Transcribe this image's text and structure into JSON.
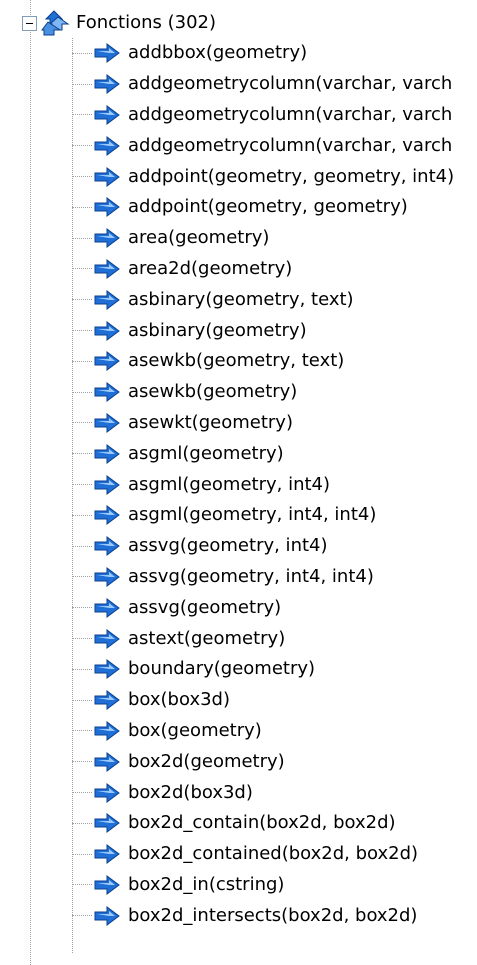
{
  "tree": {
    "root": {
      "label": "Fonctions (302)",
      "icon": "functions-folder-icon",
      "expanded": true
    },
    "items": [
      {
        "label": "addbbox(geometry)"
      },
      {
        "label": "addgeometrycolumn(varchar, varch"
      },
      {
        "label": "addgeometrycolumn(varchar, varch"
      },
      {
        "label": "addgeometrycolumn(varchar, varch"
      },
      {
        "label": "addpoint(geometry, geometry, int4)"
      },
      {
        "label": "addpoint(geometry, geometry)"
      },
      {
        "label": "area(geometry)"
      },
      {
        "label": "area2d(geometry)"
      },
      {
        "label": "asbinary(geometry, text)"
      },
      {
        "label": "asbinary(geometry)"
      },
      {
        "label": "asewkb(geometry, text)"
      },
      {
        "label": "asewkb(geometry)"
      },
      {
        "label": "asewkt(geometry)"
      },
      {
        "label": "asgml(geometry)"
      },
      {
        "label": "asgml(geometry, int4)"
      },
      {
        "label": "asgml(geometry, int4, int4)"
      },
      {
        "label": "assvg(geometry, int4)"
      },
      {
        "label": "assvg(geometry, int4, int4)"
      },
      {
        "label": "assvg(geometry)"
      },
      {
        "label": "astext(geometry)"
      },
      {
        "label": "boundary(geometry)"
      },
      {
        "label": "box(box3d)"
      },
      {
        "label": "box(geometry)"
      },
      {
        "label": "box2d(geometry)"
      },
      {
        "label": "box2d(box3d)"
      },
      {
        "label": "box2d_contain(box2d, box2d)"
      },
      {
        "label": "box2d_contained(box2d, box2d)"
      },
      {
        "label": "box2d_in(cstring)"
      },
      {
        "label": "box2d_intersects(box2d, box2d)"
      }
    ],
    "item_icon": "function-arrow-icon",
    "colors": {
      "icon_blue": "#1f6fd6",
      "icon_light": "#a9d3ff",
      "connector": "#a0a0a0"
    }
  }
}
